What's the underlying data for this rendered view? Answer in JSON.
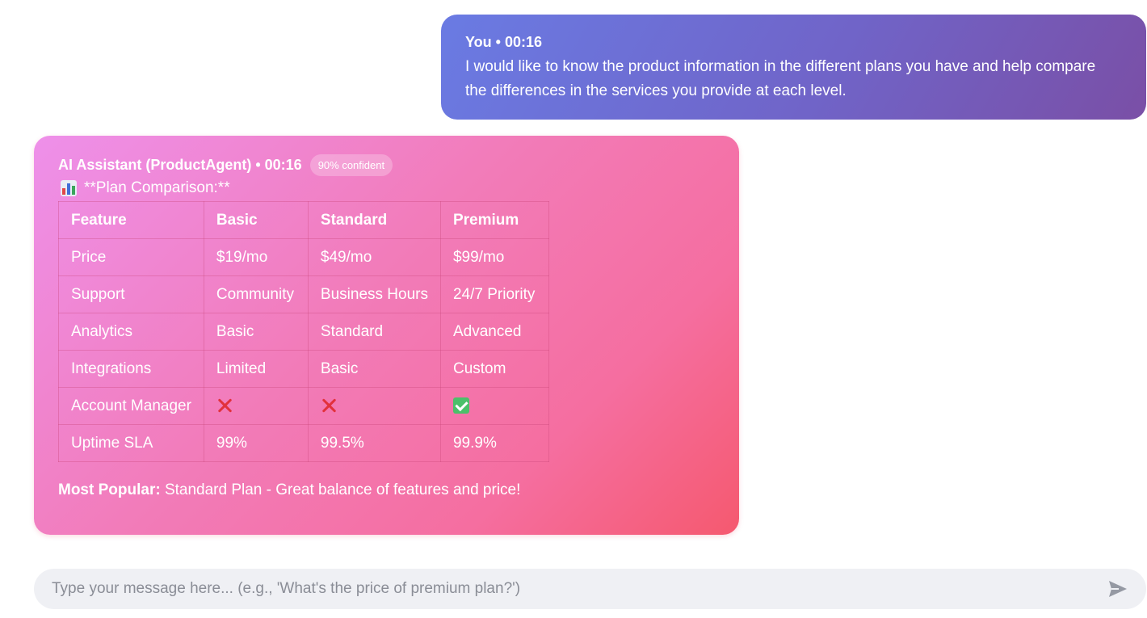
{
  "user_message": {
    "meta": "You • 00:16",
    "text": "I would like to know the product information in the different plans you have and help compare the differences in the services you provide at each level."
  },
  "ai_message": {
    "meta": "AI Assistant (ProductAgent) • 00:16",
    "confidence_badge": "90% confident",
    "heading_icon": "bar-chart-icon",
    "heading": "**Plan Comparison:**",
    "table": {
      "headers": [
        "Feature",
        "Basic",
        "Standard",
        "Premium"
      ],
      "rows": [
        [
          "Price",
          "$19/mo",
          "$49/mo",
          "$99/mo"
        ],
        [
          "Support",
          "Community",
          "Business Hours",
          "24/7 Priority"
        ],
        [
          "Analytics",
          "Basic",
          "Standard",
          "Advanced"
        ],
        [
          "Integrations",
          "Limited",
          "Basic",
          "Custom"
        ],
        [
          "Account Manager",
          "cross-mark-icon",
          "cross-mark-icon",
          "check-mark-icon"
        ],
        [
          "Uptime SLA",
          "99%",
          "99.5%",
          "99.9%"
        ]
      ]
    },
    "popular_label": "Most Popular:",
    "popular_text": " Standard Plan - Great balance of features and price!"
  },
  "input": {
    "placeholder": "Type your message here... (e.g., 'What's the price of premium plan?')",
    "value": "",
    "send_icon": "send-icon"
  },
  "colors": {
    "user_bubble_start": "#6a7be3",
    "user_bubble_end": "#7a4fa6",
    "ai_bubble_start": "#ee90ea",
    "ai_bubble_end": "#f5596f",
    "input_bg": "#eff0f4"
  }
}
